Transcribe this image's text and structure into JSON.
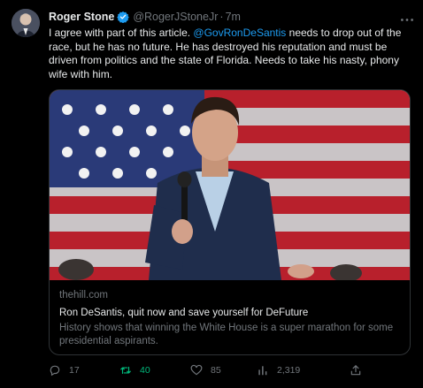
{
  "author": {
    "name": "Roger Stone",
    "handle": "@RogerJStoneJr",
    "separator": "·",
    "time": "7m",
    "verified_color": "#1d9bf0"
  },
  "tweet": {
    "text_before": "I agree with part of this article. ",
    "mention": "@GovRonDeSantis",
    "text_after": " needs to drop out of the race, but he has no future. He has destroyed his reputation and must be driven from politics and the state of Florida. Needs to take his nasty, phony wife with him."
  },
  "card": {
    "domain": "thehill.com",
    "title": "Ron DeSantis, quit now and save yourself for DeFuture",
    "description": "History shows that winning the White House is a super marathon for some presidential aspirants."
  },
  "actions": {
    "replies": "17",
    "retweets": "40",
    "likes": "85",
    "views": "2,319"
  },
  "icons": {
    "more": "more-icon",
    "reply": "reply-icon",
    "retweet": "retweet-icon",
    "like": "heart-icon",
    "views": "views-icon",
    "share": "share-icon"
  },
  "colors": {
    "background": "#000000",
    "link": "#1d9bf0",
    "secondary_text": "#71767b",
    "retweet_active": "#00ba7c",
    "card_border": "#2f3336"
  }
}
